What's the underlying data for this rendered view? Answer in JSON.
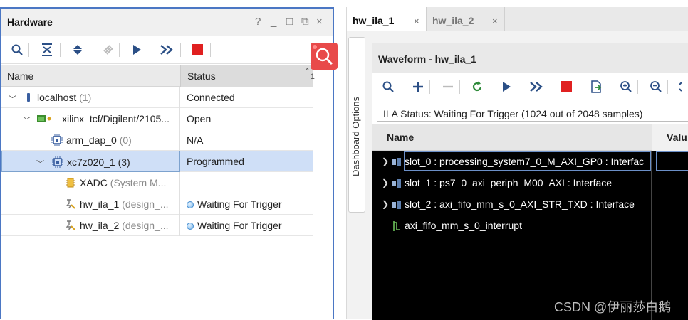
{
  "hardware_panel": {
    "title": "Hardware",
    "window_buttons": [
      "?",
      "_",
      "□",
      "⧉",
      "×"
    ],
    "columns": {
      "name": "Name",
      "status": "Status",
      "sort_indicator": "1"
    },
    "rows": [
      {
        "name": "localhost",
        "suffix": "(1)",
        "status": "Connected"
      },
      {
        "name": "xilinx_tcf/Digilent/2105...",
        "suffix": "",
        "status": "Open"
      },
      {
        "name": "arm_dap_0",
        "suffix": "(0)",
        "status": "N/A"
      },
      {
        "name": "xc7z020_1",
        "suffix": "(3)",
        "status": "Programmed"
      },
      {
        "name": "XADC",
        "suffix": "(System M...",
        "status": ""
      },
      {
        "name": "hw_ila_1",
        "suffix": "(design_...",
        "status": "Waiting For Trigger"
      },
      {
        "name": "hw_ila_2",
        "suffix": "(design_...",
        "status": "Waiting For Trigger"
      }
    ]
  },
  "tabs": [
    {
      "label": "hw_ila_1",
      "close": "×"
    },
    {
      "label": "hw_ila_2",
      "close": "×"
    }
  ],
  "dashboard_options": "Dashboard Options",
  "waveform": {
    "title": "Waveform - hw_ila_1",
    "ila_status": "ILA Status:  Waiting For Trigger (1024 out of 2048 samples)",
    "columns": {
      "name": "Name",
      "value": "Valu"
    },
    "signals": [
      {
        "name": "slot_0 : processing_system7_0_M_AXI_GP0 : Interfac",
        "expandable": true
      },
      {
        "name": "slot_1 : ps7_0_axi_periph_M00_AXI : Interface",
        "expandable": true
      },
      {
        "name": "slot_2 : axi_fifo_mm_s_0_AXI_STR_TXD : Interface",
        "expandable": true
      },
      {
        "name": "axi_fifo_mm_s_0_interrupt",
        "expandable": false
      }
    ]
  },
  "watermark": "CSDN @伊丽莎白鹅",
  "colors": {
    "accent_blue": "#4b77c4",
    "stop_red": "#e02020",
    "selection": "#cfdff7"
  }
}
